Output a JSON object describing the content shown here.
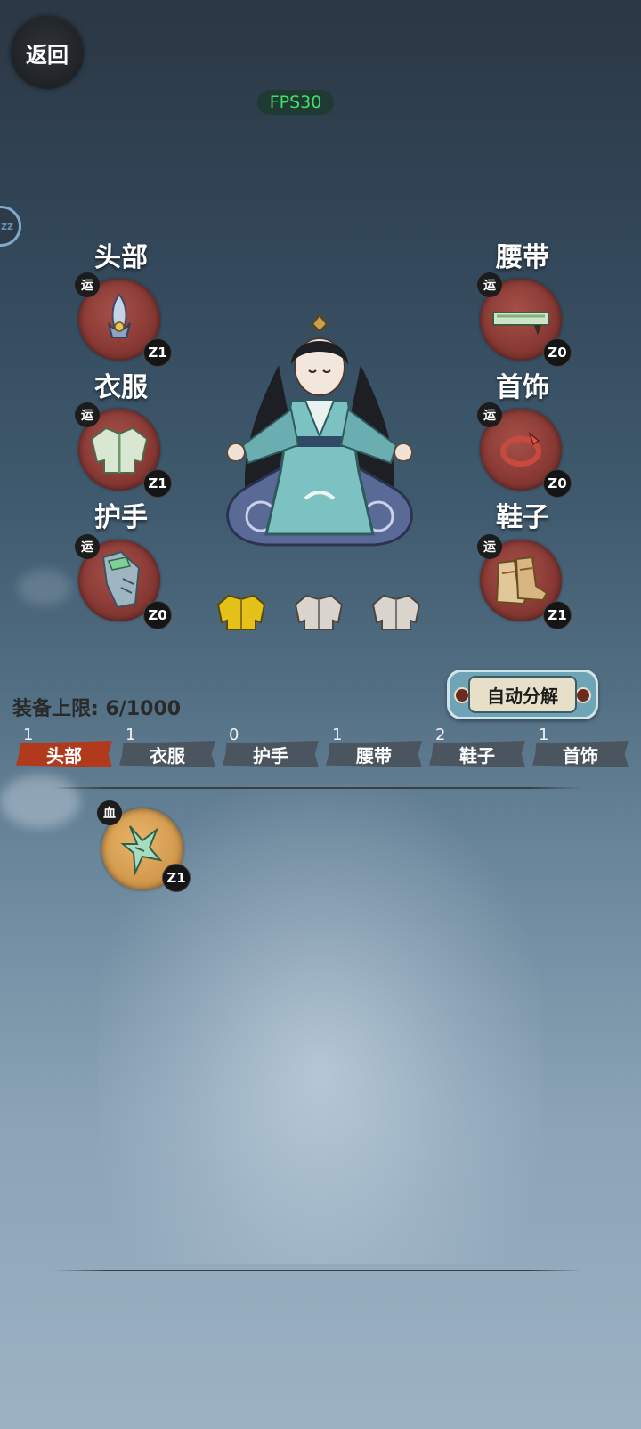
{
  "header": {
    "back_label": "返回",
    "fps_label": "FPS30",
    "side_badge_text": "zz"
  },
  "slots": {
    "head": {
      "label": "头部",
      "tag": "运",
      "level": "Z1"
    },
    "clothes": {
      "label": "衣服",
      "tag": "运",
      "level": "Z1"
    },
    "gloves": {
      "label": "护手",
      "tag": "运",
      "level": "Z0"
    },
    "belt": {
      "label": "腰带",
      "tag": "运",
      "level": "Z0"
    },
    "jewelry": {
      "label": "首饰",
      "tag": "运",
      "level": "Z0"
    },
    "shoes": {
      "label": "鞋子",
      "tag": "运",
      "level": "Z1"
    }
  },
  "outfit_presets": [
    "gold-robe-icon",
    "grey-robe-icon",
    "grey-robe-icon"
  ],
  "inventory_info": {
    "capacity_label": "装备上限:",
    "capacity_value": "6/1000"
  },
  "auto_decompose_label": "自动分解",
  "tabs": [
    {
      "label": "头部",
      "count": "1",
      "active": true
    },
    {
      "label": "衣服",
      "count": "1",
      "active": false
    },
    {
      "label": "护手",
      "count": "0",
      "active": false
    },
    {
      "label": "腰带",
      "count": "1",
      "active": false
    },
    {
      "label": "鞋子",
      "count": "2",
      "active": false
    },
    {
      "label": "首饰",
      "count": "1",
      "active": false
    }
  ],
  "inventory_items": [
    {
      "tag": "血",
      "level": "Z1",
      "icon": "jade-hairpin-icon"
    }
  ],
  "colors": {
    "slot_red": "#8a3a35",
    "item_gold": "#d39a4e",
    "tab_active": "#b23a1c",
    "tab_inactive": "#4a5560",
    "fps_green": "#3ee06a"
  }
}
